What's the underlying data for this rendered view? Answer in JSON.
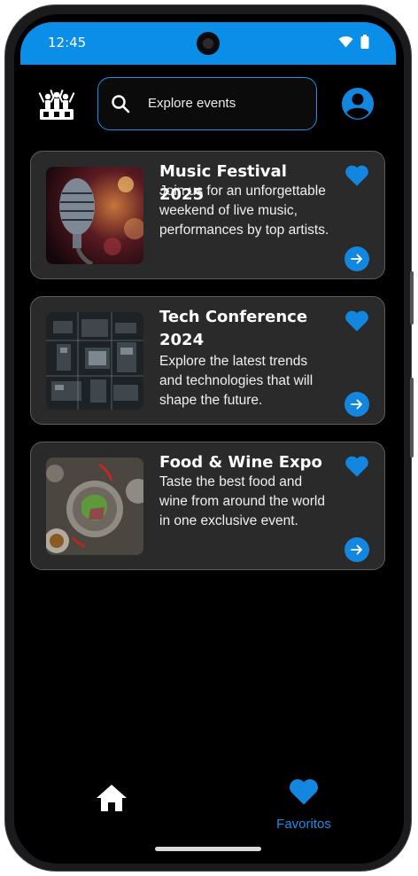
{
  "status_bar": {
    "time": "12:45",
    "icons": [
      "wifi-icon",
      "battery-icon"
    ]
  },
  "header": {
    "logo_icon": "crowd-logo-icon",
    "search_placeholder": "Explore events",
    "profile_icon": "account-circle-icon"
  },
  "events": [
    {
      "title": "Music Festival 2025",
      "description": "Join us for an unforgettable weekend of live music, performances by top artists.",
      "description_visible": "Join us for an unforgettable weekend of live music, perform...",
      "image": "microphone-photo",
      "favorite": true
    },
    {
      "title": "Tech Conference 2024",
      "description": "Explore the latest trends and technologies that will shape the future.",
      "description_visible": "Explore the latest trends and technologies that will ...",
      "image": "circuit-board-photo",
      "favorite": true
    },
    {
      "title": "Food & Wine Expo",
      "description": "Taste the best food and wine from around the world in one exclusive event.",
      "description_visible": "Taste the best food and wine from around the world in one exclusive ...",
      "image": "food-plates-photo",
      "favorite": true
    }
  ],
  "bottom_nav": {
    "home_icon": "home-icon",
    "favorites_label": "Favoritos",
    "favorites_icon": "heart-icon"
  },
  "colors": {
    "accent": "#1387E0",
    "status_bar": "#0A8EE8",
    "background": "#000000",
    "card": "#2A2A2A"
  }
}
